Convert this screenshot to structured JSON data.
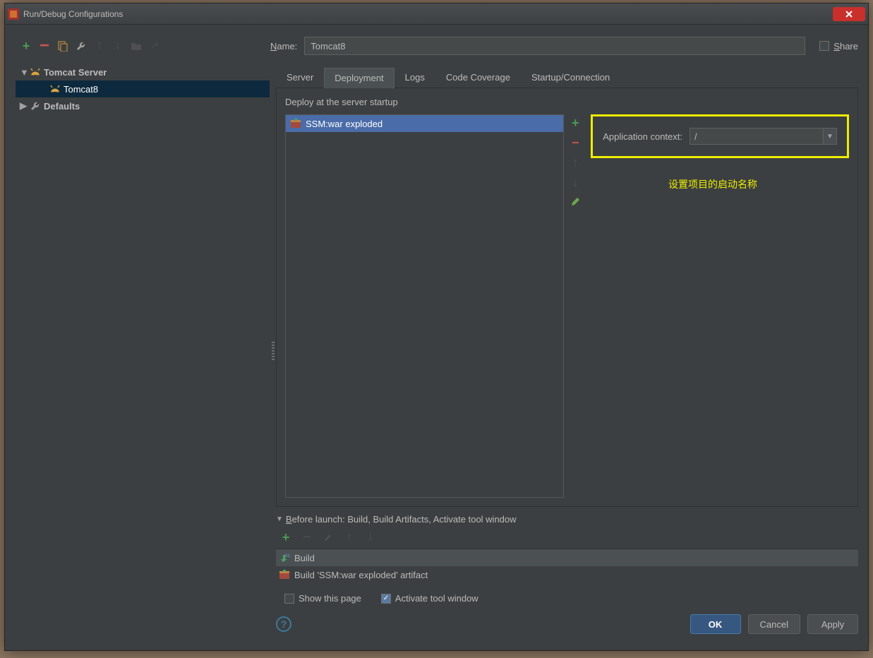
{
  "window": {
    "title": "Run/Debug Configurations"
  },
  "name": {
    "label_prefix": "N",
    "label_rest": "ame:",
    "value": "Tomcat8"
  },
  "share": {
    "label_prefix": "S",
    "label_rest": "hare"
  },
  "tree": {
    "group": "Tomcat Server",
    "item": "Tomcat8",
    "defaults": "Defaults"
  },
  "tabs": [
    "Server",
    "Deployment",
    "Logs",
    "Code Coverage",
    "Startup/Connection"
  ],
  "active_tab": 1,
  "deploy": {
    "section_label": "Deploy at the server startup",
    "artifact": "SSM:war exploded",
    "context_label": "Application context:",
    "context_value": "/"
  },
  "annotation": "设置项目的启动名称",
  "before_launch": {
    "header_prefix": "B",
    "header_rest": "efore launch: Build, Build Artifacts, Activate tool window",
    "items": [
      "Build",
      "Build 'SSM:war exploded' artifact"
    ],
    "show_page": "Show this page",
    "activate_tw": "Activate tool window"
  },
  "buttons": {
    "ok": "OK",
    "cancel": "Cancel",
    "apply": "Apply"
  }
}
